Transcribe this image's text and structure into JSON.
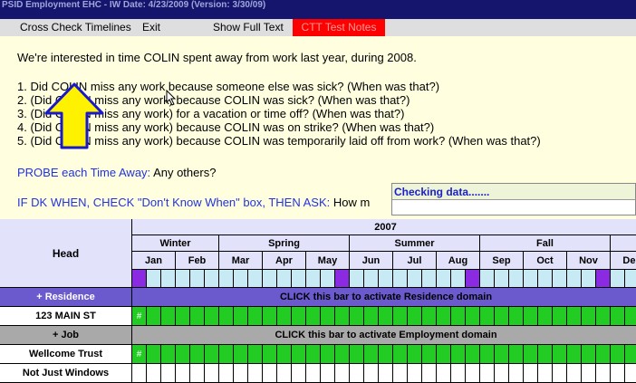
{
  "window": {
    "title": "PSID Employment EHC - IW Date: 4/23/2009 (Version: 3/30/09)"
  },
  "menu": {
    "cross_check": "Cross Check Timelines",
    "exit": "Exit",
    "show_full_text": "Show Full Text",
    "ctt_test_notes": "CTT Test Notes"
  },
  "question": {
    "intro": "We're interested in time COLIN spent away from work last year, during 2008.",
    "items": [
      "1. Did COLIN miss any work because someone else was sick? (When was that?)",
      "2. (Did COLIN miss any work) because COLIN was sick? (When was that?)",
      "3. (Did COLIN miss any work) for a vacation or time off? (When was that?)",
      "4. (Did COLIN miss any work) because COLIN was on strike? (When was that?)",
      "5. (Did COLIN miss any work) because COLIN was temporarily laid off from work? (When was that?)"
    ],
    "probe_label": "PROBE each Time Away:",
    "probe_text": " Any others?",
    "dk_label": "IF DK WHEN, CHECK \"Don't Know When\" box, THEN ASK:",
    "dk_text": " How m"
  },
  "popup": {
    "title": "Checking data......."
  },
  "grid": {
    "head_label": "Head",
    "year": "2007",
    "seasons": [
      "Winter",
      "Spring",
      "Summer",
      "Fall"
    ],
    "months": [
      "Jan",
      "Feb",
      "Mar",
      "Apr",
      "May",
      "Jun",
      "Jul",
      "Aug",
      "Sep",
      "Oct",
      "Nov",
      "Dec"
    ],
    "rows": [
      {
        "label": "+ Residence",
        "kind": "domain",
        "bar_text": "CLICK this bar to activate Residence domain"
      },
      {
        "label": "123 MAIN ST",
        "kind": "entry",
        "marker": "#",
        "fill": "green"
      },
      {
        "label": "+ Job",
        "kind": "domain2",
        "bar_text": "CLICK this bar to activate Employment domain"
      },
      {
        "label": "Wellcome Trust",
        "kind": "entry",
        "marker": "#",
        "fill": "green"
      },
      {
        "label": "Not Just Windows",
        "kind": "entry",
        "marker": "",
        "fill": "white"
      }
    ]
  },
  "colors": {
    "titlebar": "#15156e",
    "ctt_button": "#ff0000",
    "domain_bar": "#6a5acd",
    "job_bar": "#a9a9a9",
    "green_cell": "#22cc22",
    "arrow": "#fff200"
  },
  "icons": [
    "up-arrow-overlay-icon",
    "mouse-cursor-icon"
  ]
}
